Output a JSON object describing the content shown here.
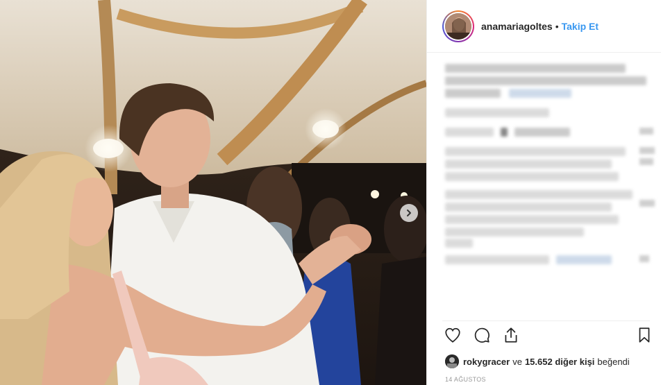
{
  "post": {
    "photo_alt": "",
    "carousel_next": "chevron-right-icon"
  },
  "header": {
    "username": "anamariagoltes",
    "separator": "•",
    "follow_label": "Takip Et"
  },
  "actions": {
    "like": "heart-icon",
    "comment": "comment-icon",
    "share": "share-icon",
    "save": "bookmark-icon"
  },
  "likes": {
    "liker": "rokygracer",
    "connector": "ve",
    "others_count": "15.652 diğer kişi",
    "suffix": "beğendi"
  },
  "date": "14 AĞUSTOS",
  "colors": {
    "accent": "#3897f0",
    "text": "#262626",
    "muted": "#999999",
    "border": "#efefef"
  }
}
